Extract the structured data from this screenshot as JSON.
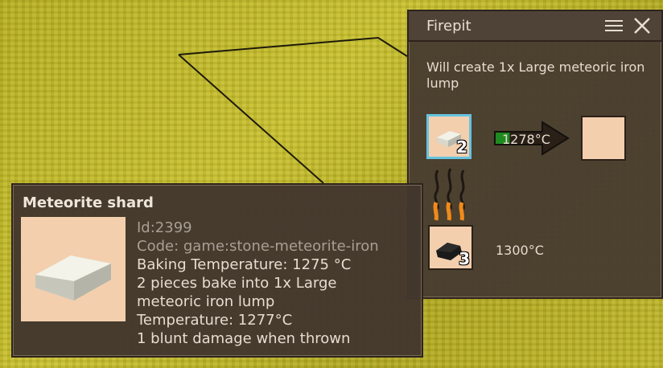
{
  "firepit": {
    "title": "Firepit",
    "info": "Will create 1x Large meteoric iron lump",
    "input_count": "2",
    "fuel_count": "3",
    "progress_temp": "1278°C",
    "fuel_temp": "1300°C",
    "progress_fraction": 0.3
  },
  "tooltip": {
    "name": "Meteorite shard",
    "lines": [
      "Id:2399",
      "Code: game:stone-meteorite-iron",
      "Baking Temperature: 1275 °C",
      "2 pieces bake into 1x Large",
      "meteoric iron lump",
      "Temperature: 1277°C",
      "1 blunt damage when thrown"
    ]
  },
  "colors": {
    "panel_bg": "#483c30",
    "slot_bg": "#f3cfae",
    "selected_slot": "#66c3e0",
    "progress_green": "#1f8a1f",
    "flame_orange": "#f08a1a"
  },
  "icons": [
    "menu-icon",
    "close-icon",
    "meteorite-shard-icon",
    "coal-icon",
    "flame-icon",
    "arrow-icon"
  ]
}
